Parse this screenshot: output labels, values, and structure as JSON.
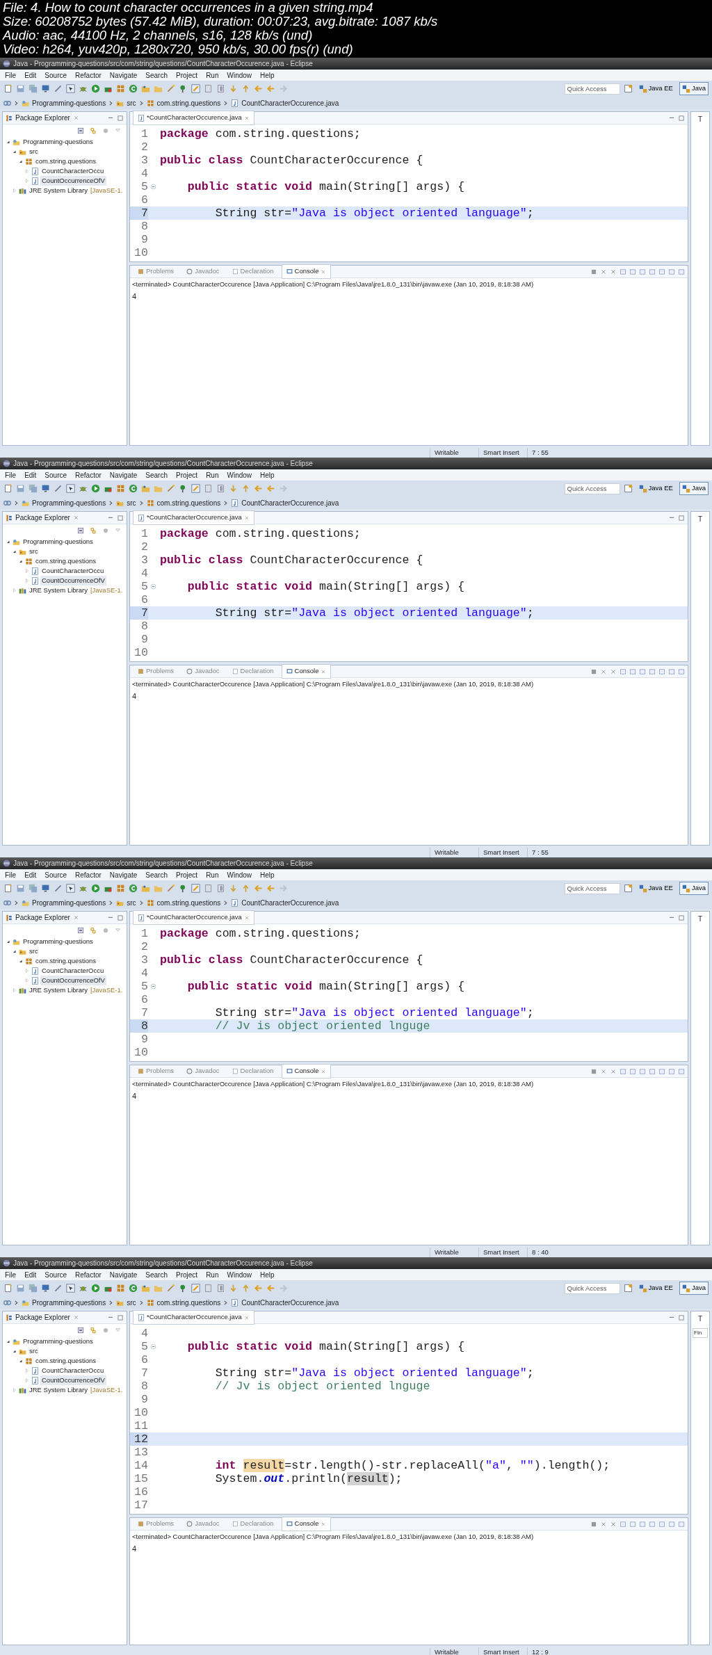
{
  "header": {
    "lines": [
      "File: 4. How to count character occurrences in a given string.mp4",
      "Size: 60208752 bytes (57.42 MiB), duration: 00:07:23, avg.bitrate: 1087 kb/s",
      "Audio: aac, 44100 Hz, 2 channels, s16, 128 kb/s (und)",
      "Video: h264, yuv420p, 1280x720, 950 kb/s, 30.00 fps(r) (und)"
    ]
  },
  "frames": [
    {
      "title": "Java - Programming-questions/src/com/string/questions/CountCharacterOccurence.java - Eclipse",
      "menu": [
        "File",
        "Edit",
        "Source",
        "Refactor",
        "Navigate",
        "Search",
        "Project",
        "Run",
        "Window",
        "Help"
      ],
      "quick_access": {
        "placeholder": "Quick Access"
      },
      "perspectives": [
        {
          "label": "Java EE",
          "selected": false
        },
        {
          "label": "Java",
          "selected": true
        }
      ],
      "breadcrumb": [
        {
          "kind": "project",
          "label": "Programming-questions"
        },
        {
          "kind": "folder",
          "label": "src"
        },
        {
          "kind": "package",
          "label": "com.string.questions"
        },
        {
          "kind": "java",
          "label": "CountCharacterOccurence.java"
        }
      ],
      "explorer": {
        "title": "Package Explorer",
        "tree": [
          {
            "kind": "project",
            "label": "Programming-questions",
            "expanded": true,
            "selected": false,
            "children": [
              {
                "kind": "folder",
                "label": "src",
                "expanded": true,
                "selected": false,
                "children": [
                  {
                    "kind": "package",
                    "label": "com.string.questions",
                    "expanded": true,
                    "selected": false,
                    "children": [
                      {
                        "kind": "java",
                        "label": "CountCharacterOccu",
                        "expanded": false,
                        "selected": false
                      },
                      {
                        "kind": "java",
                        "label": "CountOccurrenceOfV",
                        "expanded": false,
                        "selected": true
                      }
                    ]
                  }
                ]
              },
              {
                "kind": "library",
                "label": "JRE System Library",
                "suffix": "[JavaSE-1.",
                "expanded": false,
                "selected": false
              }
            ]
          }
        ]
      },
      "editor": {
        "tab": "*CountCharacterOccurence.java",
        "lines": [
          {
            "number": "1",
            "current": false,
            "tokens": [
              {
                "kind": "keyword",
                "text": "package"
              },
              {
                "kind": "plain",
                "text": " com.string.questions;"
              }
            ]
          },
          {
            "number": "2",
            "current": false
          },
          {
            "number": "3",
            "current": false,
            "tokens": [
              {
                "kind": "keyword",
                "text": "public class"
              },
              {
                "kind": "plain",
                "text": " CountCharacterOccurence {"
              }
            ]
          },
          {
            "number": "4",
            "current": false
          },
          {
            "number": "5",
            "current": false,
            "fold": true,
            "tokens": [
              {
                "kind": "keyword",
                "text": "    public static void"
              },
              {
                "kind": "plain",
                "text": " main(String[] args) {"
              }
            ]
          },
          {
            "number": "6",
            "current": false
          },
          {
            "number": "7",
            "current": true,
            "tokens": [
              {
                "kind": "plain",
                "text": "        String str="
              },
              {
                "kind": "string",
                "text": "\"Java is object oriented language\""
              },
              {
                "kind": "plain",
                "text": ";"
              }
            ]
          },
          {
            "number": "8",
            "current": false
          },
          {
            "number": "9",
            "current": false
          },
          {
            "number": "10",
            "current": false
          }
        ]
      },
      "right_panel": {
        "tab": "T"
      },
      "console": {
        "tabs": [
          {
            "label": "Problems",
            "selected": false
          },
          {
            "label": "Javadoc",
            "selected": false
          },
          {
            "label": "Declaration",
            "selected": false
          },
          {
            "label": "Console",
            "selected": true
          }
        ],
        "status": "<terminated> CountCharacterOccurence [Java Application] C:\\Program Files\\Java\\jre1.8.0_131\\bin\\javaw.exe (Jan 10, 2019, 8:18:38 AM)",
        "output": "4"
      },
      "status_bar": [
        "Writable",
        "Smart Insert",
        "7 : 55"
      ]
    },
    {
      "title": "Java - Programming-questions/src/com/string/questions/CountCharacterOccurence.java - Eclipse",
      "menu": [
        "File",
        "Edit",
        "Source",
        "Refactor",
        "Navigate",
        "Search",
        "Project",
        "Run",
        "Window",
        "Help"
      ],
      "quick_access": {
        "placeholder": "Quick Access"
      },
      "perspectives": [
        {
          "label": "Java EE",
          "selected": false
        },
        {
          "label": "Java",
          "selected": true
        }
      ],
      "breadcrumb": [
        {
          "kind": "project",
          "label": "Programming-questions"
        },
        {
          "kind": "folder",
          "label": "src"
        },
        {
          "kind": "package",
          "label": "com.string.questions"
        },
        {
          "kind": "java",
          "label": "CountCharacterOccurence.java"
        }
      ],
      "explorer": {
        "title": "Package Explorer",
        "tree": [
          {
            "kind": "project",
            "label": "Programming-questions",
            "expanded": true,
            "selected": false,
            "children": [
              {
                "kind": "folder",
                "label": "src",
                "expanded": true,
                "selected": false,
                "children": [
                  {
                    "kind": "package",
                    "label": "com.string.questions",
                    "expanded": true,
                    "selected": false,
                    "children": [
                      {
                        "kind": "java",
                        "label": "CountCharacterOccu",
                        "expanded": false,
                        "selected": false
                      },
                      {
                        "kind": "java",
                        "label": "CountOccurrenceOfV",
                        "expanded": false,
                        "selected": true
                      }
                    ]
                  }
                ]
              },
              {
                "kind": "library",
                "label": "JRE System Library",
                "suffix": "[JavaSE-1.",
                "expanded": false,
                "selected": false
              }
            ]
          }
        ]
      },
      "editor": {
        "tab": "*CountCharacterOccurence.java",
        "lines": [
          {
            "number": "1",
            "current": false,
            "tokens": [
              {
                "kind": "keyword",
                "text": "package"
              },
              {
                "kind": "plain",
                "text": " com.string.questions;"
              }
            ]
          },
          {
            "number": "2",
            "current": false
          },
          {
            "number": "3",
            "current": false,
            "tokens": [
              {
                "kind": "keyword",
                "text": "public class"
              },
              {
                "kind": "plain",
                "text": " CountCharacterOccurence {"
              }
            ]
          },
          {
            "number": "4",
            "current": false
          },
          {
            "number": "5",
            "current": false,
            "fold": true,
            "tokens": [
              {
                "kind": "keyword",
                "text": "    public static void"
              },
              {
                "kind": "plain",
                "text": " main(String[] args) {"
              }
            ]
          },
          {
            "number": "6",
            "current": false
          },
          {
            "number": "7",
            "current": true,
            "tokens": [
              {
                "kind": "plain",
                "text": "        String str="
              },
              {
                "kind": "string",
                "text": "\"Java is object oriented language\""
              },
              {
                "kind": "plain",
                "text": ";"
              }
            ]
          },
          {
            "number": "8",
            "current": false
          },
          {
            "number": "9",
            "current": false
          },
          {
            "number": "10",
            "current": false
          }
        ]
      },
      "right_panel": {
        "tab": "T"
      },
      "console": {
        "tabs": [
          {
            "label": "Problems",
            "selected": false
          },
          {
            "label": "Javadoc",
            "selected": false
          },
          {
            "label": "Declaration",
            "selected": false
          },
          {
            "label": "Console",
            "selected": true
          }
        ],
        "status": "<terminated> CountCharacterOccurence [Java Application] C:\\Program Files\\Java\\jre1.8.0_131\\bin\\javaw.exe (Jan 10, 2019, 8:18:38 AM)",
        "output": "4"
      },
      "status_bar": [
        "Writable",
        "Smart Insert",
        "7 : 55"
      ]
    },
    {
      "title": "Java - Programming-questions/src/com/string/questions/CountCharacterOccurence.java - Eclipse",
      "menu": [
        "File",
        "Edit",
        "Source",
        "Refactor",
        "Navigate",
        "Search",
        "Project",
        "Run",
        "Window",
        "Help"
      ],
      "quick_access": {
        "placeholder": "Quick Access"
      },
      "perspectives": [
        {
          "label": "Java EE",
          "selected": false
        },
        {
          "label": "Java",
          "selected": true
        }
      ],
      "breadcrumb": [
        {
          "kind": "project",
          "label": "Programming-questions"
        },
        {
          "kind": "folder",
          "label": "src"
        },
        {
          "kind": "package",
          "label": "com.string.questions"
        },
        {
          "kind": "java",
          "label": "CountCharacterOccurence.java"
        }
      ],
      "explorer": {
        "title": "Package Explorer",
        "tree": [
          {
            "kind": "project",
            "label": "Programming-questions",
            "expanded": true,
            "selected": false,
            "children": [
              {
                "kind": "folder",
                "label": "src",
                "expanded": true,
                "selected": false,
                "children": [
                  {
                    "kind": "package",
                    "label": "com.string.questions",
                    "expanded": true,
                    "selected": false,
                    "children": [
                      {
                        "kind": "java",
                        "label": "CountCharacterOccu",
                        "expanded": false,
                        "selected": false
                      },
                      {
                        "kind": "java",
                        "label": "CountOccurrenceOfV",
                        "expanded": false,
                        "selected": true
                      }
                    ]
                  }
                ]
              },
              {
                "kind": "library",
                "label": "JRE System Library",
                "suffix": "[JavaSE-1.",
                "expanded": false,
                "selected": false
              }
            ]
          }
        ]
      },
      "editor": {
        "tab": "*CountCharacterOccurence.java",
        "lines": [
          {
            "number": "1",
            "current": false,
            "tokens": [
              {
                "kind": "keyword",
                "text": "package"
              },
              {
                "kind": "plain",
                "text": " com.string.questions;"
              }
            ]
          },
          {
            "number": "2",
            "current": false
          },
          {
            "number": "3",
            "current": false,
            "tokens": [
              {
                "kind": "keyword",
                "text": "public class"
              },
              {
                "kind": "plain",
                "text": " CountCharacterOccurence {"
              }
            ]
          },
          {
            "number": "4",
            "current": false
          },
          {
            "number": "5",
            "current": false,
            "fold": true,
            "tokens": [
              {
                "kind": "keyword",
                "text": "    public static void"
              },
              {
                "kind": "plain",
                "text": " main(String[] args) {"
              }
            ]
          },
          {
            "number": "6",
            "current": false
          },
          {
            "number": "7",
            "current": false,
            "tokens": [
              {
                "kind": "plain",
                "text": "        String str="
              },
              {
                "kind": "string",
                "text": "\"Java is object oriented language\""
              },
              {
                "kind": "plain",
                "text": ";"
              }
            ]
          },
          {
            "number": "8",
            "current": true,
            "tokens": [
              {
                "kind": "comment",
                "text": "        // Jv is object oriented lnguge"
              }
            ]
          },
          {
            "number": "9",
            "current": false
          },
          {
            "number": "10",
            "current": false
          }
        ]
      },
      "right_panel": {
        "tab": "T"
      },
      "console": {
        "tabs": [
          {
            "label": "Problems",
            "selected": false
          },
          {
            "label": "Javadoc",
            "selected": false
          },
          {
            "label": "Declaration",
            "selected": false
          },
          {
            "label": "Console",
            "selected": true
          }
        ],
        "status": "<terminated> CountCharacterOccurence [Java Application] C:\\Program Files\\Java\\jre1.8.0_131\\bin\\javaw.exe (Jan 10, 2019, 8:18:38 AM)",
        "output": "4"
      },
      "status_bar": [
        "Writable",
        "Smart Insert",
        "8 : 40"
      ]
    },
    {
      "title": "Java - Programming-questions/src/com/string/questions/CountCharacterOccurence.java - Eclipse",
      "menu": [
        "File",
        "Edit",
        "Source",
        "Refactor",
        "Navigate",
        "Search",
        "Project",
        "Run",
        "Window",
        "Help"
      ],
      "quick_access": {
        "placeholder": "Quick Access"
      },
      "perspectives": [
        {
          "label": "Java EE",
          "selected": false
        },
        {
          "label": "Java",
          "selected": true
        }
      ],
      "breadcrumb": [
        {
          "kind": "project",
          "label": "Programming-questions"
        },
        {
          "kind": "folder",
          "label": "src"
        },
        {
          "kind": "package",
          "label": "com.string.questions"
        },
        {
          "kind": "java",
          "label": "CountCharacterOccurence.java"
        }
      ],
      "explorer": {
        "title": "Package Explorer",
        "tree": [
          {
            "kind": "project",
            "label": "Programming-questions",
            "expanded": true,
            "selected": false,
            "children": [
              {
                "kind": "folder",
                "label": "src",
                "expanded": true,
                "selected": false,
                "children": [
                  {
                    "kind": "package",
                    "label": "com.string.questions",
                    "expanded": true,
                    "selected": false,
                    "children": [
                      {
                        "kind": "java",
                        "label": "CountCharacterOccu",
                        "expanded": false,
                        "selected": false
                      },
                      {
                        "kind": "java",
                        "label": "CountOccurrenceOfV",
                        "expanded": false,
                        "selected": true
                      }
                    ]
                  }
                ]
              },
              {
                "kind": "library",
                "label": "JRE System Library",
                "suffix": "[JavaSE-1.",
                "expanded": false,
                "selected": false
              }
            ]
          }
        ]
      },
      "editor": {
        "tab": "*CountCharacterOccurence.java",
        "lines": [
          {
            "number": "4",
            "current": false
          },
          {
            "number": "5",
            "current": false,
            "fold": true,
            "tokens": [
              {
                "kind": "keyword",
                "text": "    public static void"
              },
              {
                "kind": "plain",
                "text": " main(String[] args) {"
              }
            ]
          },
          {
            "number": "6",
            "current": false
          },
          {
            "number": "7",
            "current": false,
            "tokens": [
              {
                "kind": "plain",
                "text": "        String str="
              },
              {
                "kind": "string",
                "text": "\"Java is object oriented language\""
              },
              {
                "kind": "plain",
                "text": ";"
              }
            ]
          },
          {
            "number": "8",
            "current": false,
            "tokens": [
              {
                "kind": "comment",
                "text": "        // Jv is object oriented lnguge"
              }
            ]
          },
          {
            "number": "9",
            "current": false
          },
          {
            "number": "10",
            "current": false
          },
          {
            "number": "11",
            "current": false
          },
          {
            "number": "12",
            "current": true
          },
          {
            "number": "13",
            "current": false
          },
          {
            "number": "14",
            "current": false,
            "tokens": [
              {
                "kind": "keyword",
                "text": "        int "
              },
              {
                "kind": "write",
                "text": "result"
              },
              {
                "kind": "plain",
                "text": "=str.length()-str.replaceAll("
              },
              {
                "kind": "string",
                "text": "\"a\""
              },
              {
                "kind": "plain",
                "text": ", "
              },
              {
                "kind": "string",
                "text": "\"\""
              },
              {
                "kind": "plain",
                "text": ").length();"
              }
            ]
          },
          {
            "number": "15",
            "current": false,
            "tokens": [
              {
                "kind": "plain",
                "text": "        System."
              },
              {
                "kind": "field",
                "text": "out"
              },
              {
                "kind": "plain",
                "text": ".println("
              },
              {
                "kind": "read",
                "text": "result"
              },
              {
                "kind": "plain",
                "text": ");"
              }
            ]
          },
          {
            "number": "16",
            "current": false
          },
          {
            "number": "17",
            "current": false
          }
        ]
      },
      "right_panel": {
        "tab": "T",
        "find": "Fin"
      },
      "console": {
        "tabs": [
          {
            "label": "Problems",
            "selected": false
          },
          {
            "label": "Javadoc",
            "selected": false
          },
          {
            "label": "Declaration",
            "selected": false
          },
          {
            "label": "Console",
            "selected": true
          }
        ],
        "status": "<terminated> CountCharacterOccurence [Java Application] C:\\Program Files\\Java\\jre1.8.0_131\\bin\\javaw.exe (Jan 10, 2019, 8:18:38 AM)",
        "output": "4"
      },
      "status_bar": [
        "Writable",
        "Smart Insert",
        "12 : 9"
      ]
    }
  ]
}
